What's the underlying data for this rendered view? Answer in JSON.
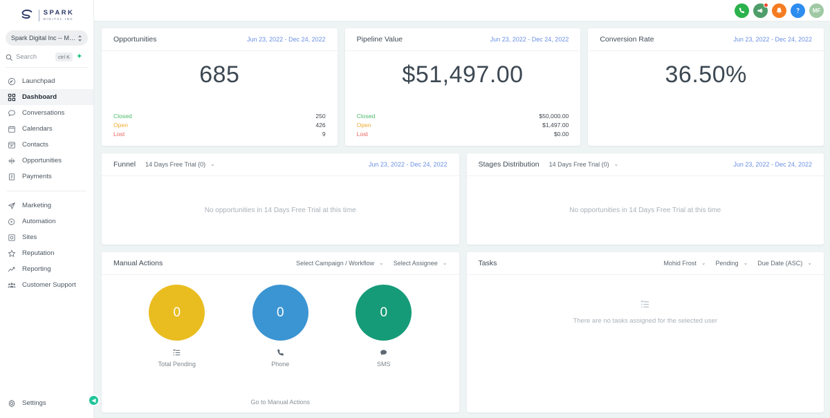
{
  "brand": {
    "logo_name": "SPARK",
    "logo_sub": "DIGITAL INC",
    "accent_green": "#1fc598",
    "link_blue": "#6b90e4"
  },
  "sidebar": {
    "account": {
      "name": "Spark Digital Inc -- Murp...",
      "icon": "updown-chevrons-icon"
    },
    "search": {
      "placeholder": "Search",
      "value": "",
      "shortcut": "ctrl K",
      "icon": "search-icon",
      "plus_icon": "sparkle-plus-icon"
    },
    "items": [
      {
        "label": "Launchpad",
        "icon": "rocket-icon",
        "active": false
      },
      {
        "label": "Dashboard",
        "icon": "grid-icon",
        "active": true
      },
      {
        "label": "Conversations",
        "icon": "chat-bubble-icon",
        "active": false
      },
      {
        "label": "Calendars",
        "icon": "calendar-icon",
        "active": false
      },
      {
        "label": "Contacts",
        "icon": "contact-card-icon",
        "active": false
      },
      {
        "label": "Opportunities",
        "icon": "funnel-nodes-icon",
        "active": false
      },
      {
        "label": "Payments",
        "icon": "receipt-icon",
        "active": false
      }
    ],
    "items2": [
      {
        "label": "Marketing",
        "icon": "paper-plane-icon"
      },
      {
        "label": "Automation",
        "icon": "play-circle-icon"
      },
      {
        "label": "Sites",
        "icon": "globe-square-icon"
      },
      {
        "label": "Reputation",
        "icon": "star-icon"
      },
      {
        "label": "Reporting",
        "icon": "trend-up-icon"
      },
      {
        "label": "Customer Support",
        "icon": "people-group-icon"
      }
    ],
    "settings": {
      "label": "Settings",
      "icon": "gear-icon"
    },
    "collapse": {
      "icon": "chevron-left-icon"
    }
  },
  "topbar": {
    "icons": [
      {
        "name": "phone-icon",
        "color": "#2bb24c",
        "badge": false
      },
      {
        "name": "megaphone-icon",
        "color": "#4f9e6a",
        "badge": true
      },
      {
        "name": "bell-icon",
        "color": "#f57c20",
        "badge": false
      },
      {
        "name": "help-question-icon",
        "color": "#2d8cf0",
        "badge": false
      }
    ],
    "avatar_initials": "MF"
  },
  "kpis": [
    {
      "title": "Opportunities",
      "date_range": "Jun 23, 2022 - Dec 24, 2022",
      "big_value": "685",
      "rows": [
        {
          "label": "Closed",
          "color": "#4cba6a",
          "value": "250"
        },
        {
          "label": "Open",
          "color": "#efab2f",
          "value": "426"
        },
        {
          "label": "Lost",
          "color": "#e8635a",
          "value": "9"
        }
      ]
    },
    {
      "title": "Pipeline Value",
      "date_range": "Jun 23, 2022 - Dec 24, 2022",
      "big_value": "$51,497.00",
      "rows": [
        {
          "label": "Closed",
          "color": "#4cba6a",
          "value": "$50,000.00"
        },
        {
          "label": "Open",
          "color": "#efab2f",
          "value": "$1,497.00"
        },
        {
          "label": "Lost",
          "color": "#e8635a",
          "value": "$0.00"
        }
      ]
    },
    {
      "title": "Conversion Rate",
      "date_range": "Jun 23, 2022 - Dec 24, 2022",
      "big_value": "36.50%",
      "rows": []
    }
  ],
  "funnel": {
    "title": "Funnel",
    "pipeline_select": "14 Days Free Trial (0)",
    "date_range": "Jun 23, 2022 - Dec 24, 2022",
    "empty_message": "No opportunities in 14 Days Free Trial at this time"
  },
  "stages": {
    "title": "Stages Distribution",
    "pipeline_select": "14 Days Free Trial (0)",
    "date_range": "Jun 23, 2022 - Dec 24, 2022",
    "empty_message": "No opportunities in 14 Days Free Trial at this time"
  },
  "manual_actions": {
    "title": "Manual Actions",
    "campaign_select": "Select Campaign / Workflow",
    "assignee_select": "Select Assignee",
    "link": "Go to Manual Actions",
    "circles": [
      {
        "value": "0",
        "label": "Total Pending",
        "color": "#e9bd20",
        "icon": "list-check-icon"
      },
      {
        "value": "0",
        "label": "Phone",
        "color": "#3b95d3",
        "icon": "phone-icon"
      },
      {
        "value": "0",
        "label": "SMS",
        "color": "#159b77",
        "icon": "sms-bubble-icon"
      }
    ]
  },
  "tasks": {
    "title": "Tasks",
    "assignee_filter": "Mohid Frost",
    "status_filter": "Pending",
    "sort_filter": "Due Date (ASC)",
    "empty_icon": "list-check-icon",
    "empty_message": "There are no tasks assigned for the selected user"
  }
}
